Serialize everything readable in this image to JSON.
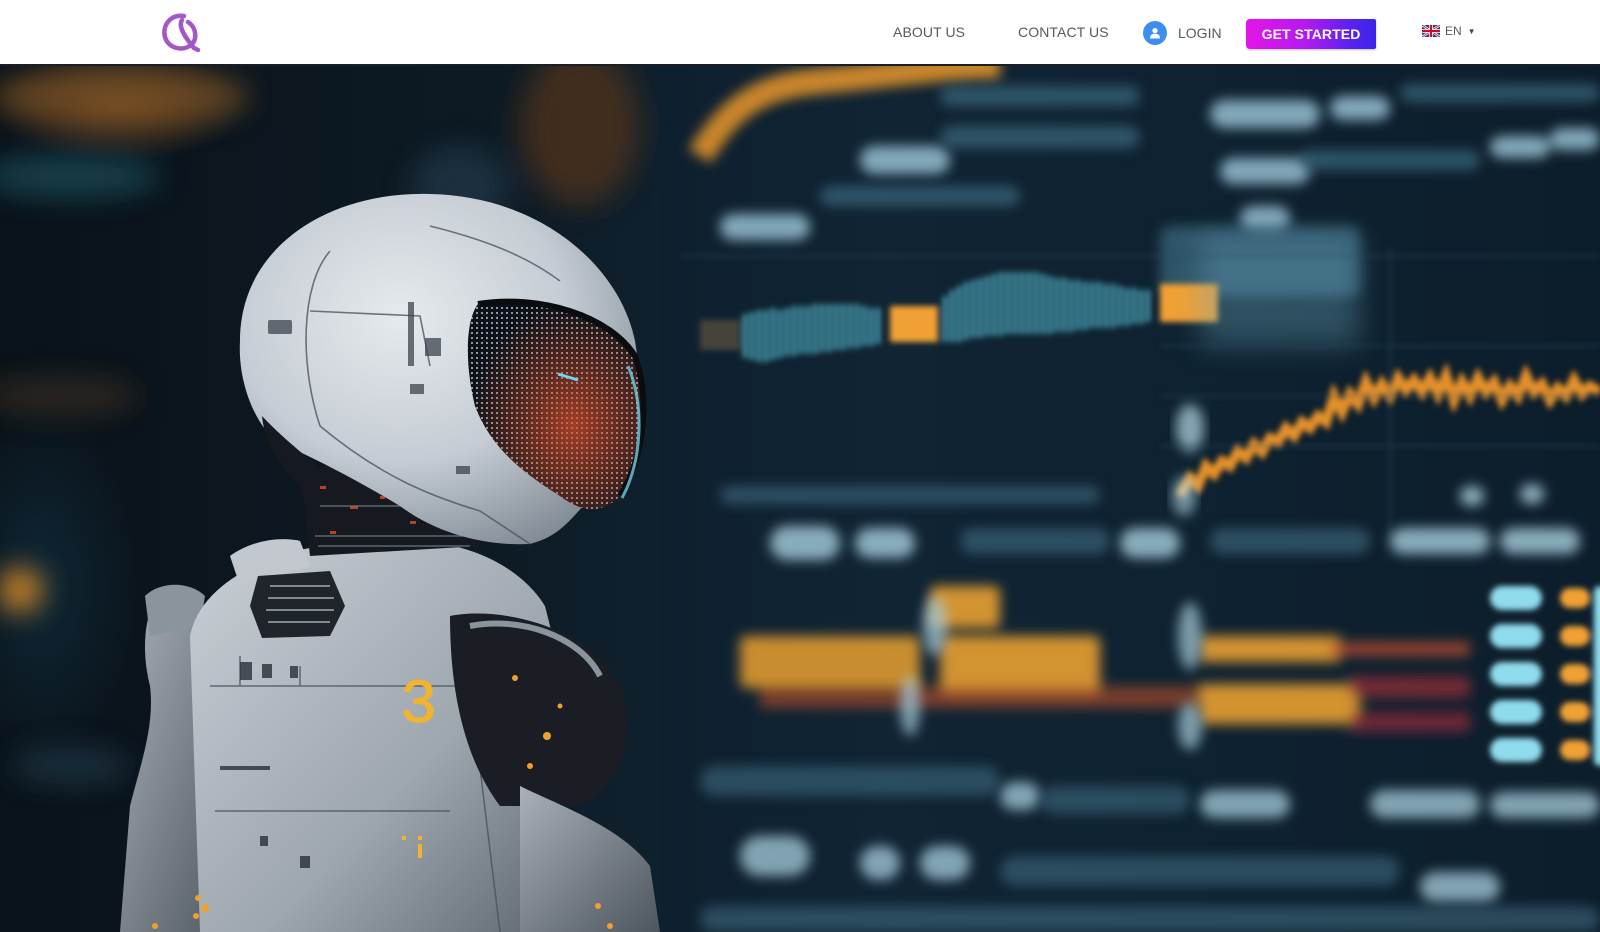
{
  "header": {
    "logo_alt": "Q logo",
    "nav": {
      "about": "ABOUT US",
      "contact": "CONTACT US",
      "login": "LOGIN",
      "get_started": "GET STARTED"
    },
    "language": {
      "selected": "EN",
      "flag_icon": "uk-flag-icon"
    },
    "colors": {
      "brand_purple": "#9b4fc4",
      "cta_gradient_start": "#e316e6",
      "cta_gradient_end": "#3b24e8",
      "login_icon_bg": "#3d8ef0",
      "nav_text": "#555a60"
    }
  },
  "hero": {
    "image_description": "White humanoid robot with visor facing a blurred financial trading dashboard",
    "robot_chest_digit": "3",
    "colors": {
      "accent_orange": "#f0a030",
      "accent_cyan": "#5fd4e8",
      "background_navy": "#0d1a24"
    }
  }
}
